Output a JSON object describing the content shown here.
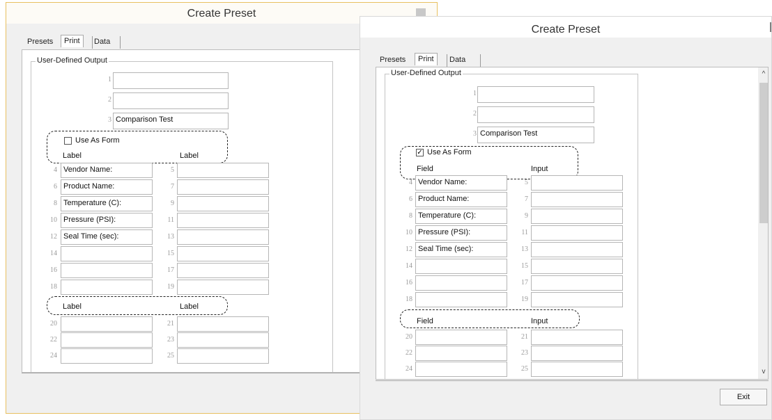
{
  "left": {
    "title": "Create Preset",
    "tabs": [
      "Presets",
      "Print",
      "Data"
    ],
    "group_title": "User-Defined Output",
    "lines": [
      "1",
      "2",
      "3"
    ],
    "line_values": [
      "",
      "",
      "Comparison Test"
    ],
    "use_as_form": {
      "label": "Use As Form",
      "checked": ""
    },
    "col_headers": [
      "Label",
      "Label"
    ],
    "rows": [
      [
        "4",
        "Vendor Name:",
        "5",
        ""
      ],
      [
        "6",
        "Product Name:",
        "7",
        ""
      ],
      [
        "8",
        "Temperature (C):",
        "9",
        ""
      ],
      [
        "10",
        "Pressure (PSI):",
        "11",
        ""
      ],
      [
        "12",
        "Seal Time (sec):",
        "13",
        ""
      ],
      [
        "14",
        "",
        "15",
        ""
      ],
      [
        "16",
        "",
        "17",
        ""
      ],
      [
        "18",
        "",
        "19",
        ""
      ]
    ],
    "col_headers2": [
      "Label",
      "Label"
    ],
    "rows2": [
      [
        "20",
        "",
        "21",
        ""
      ],
      [
        "22",
        "",
        "23",
        ""
      ],
      [
        "24",
        "",
        "25",
        ""
      ]
    ]
  },
  "right": {
    "title": "Create Preset",
    "tabs": [
      "Presets",
      "Print",
      "Data"
    ],
    "group_title": "User-Defined Output",
    "lines": [
      "1",
      "2",
      "3"
    ],
    "line_values": [
      "",
      "",
      "Comparison Test"
    ],
    "use_as_form": {
      "label": "Use As Form",
      "checked": "✓"
    },
    "col_headers": [
      "Field",
      "Input"
    ],
    "rows": [
      [
        "4",
        "Vendor Name:",
        "5",
        ""
      ],
      [
        "6",
        "Product Name:",
        "7",
        ""
      ],
      [
        "8",
        "Temperature (C):",
        "9",
        ""
      ],
      [
        "10",
        "Pressure (PSI):",
        "11",
        ""
      ],
      [
        "12",
        "Seal Time (sec):",
        "13",
        ""
      ],
      [
        "14",
        "",
        "15",
        ""
      ],
      [
        "16",
        "",
        "17",
        ""
      ],
      [
        "18",
        "",
        "19",
        ""
      ]
    ],
    "col_headers2": [
      "Field",
      "Input"
    ],
    "rows2": [
      [
        "20",
        "",
        "21",
        ""
      ],
      [
        "22",
        "",
        "23",
        ""
      ],
      [
        "24",
        "",
        "25",
        ""
      ]
    ],
    "scroll": {
      "up": "^",
      "down": "v"
    },
    "exit_label": "Exit"
  }
}
